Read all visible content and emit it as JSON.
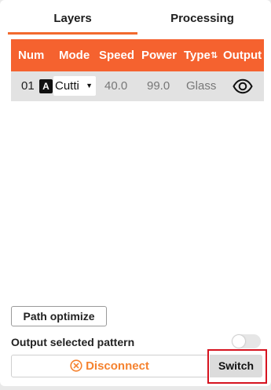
{
  "tabs": {
    "layers": "Layers",
    "processing": "Processing"
  },
  "table": {
    "headers": {
      "num": "Num",
      "mode": "Mode",
      "speed": "Speed",
      "power": "Power",
      "type": "Type",
      "type_sort": "⇅",
      "output": "Output"
    },
    "rows": [
      {
        "num": "01",
        "badge": "A",
        "mode": "Cutti",
        "speed": "40.0",
        "power": "99.0",
        "type": "Glass",
        "output_icon": "eye-icon"
      }
    ]
  },
  "controls": {
    "path_optimize": "Path optimize",
    "output_selected_label": "Output selected pattern",
    "output_selected_enabled": false,
    "disconnect": "Disconnect",
    "switch": "Switch"
  },
  "colors": {
    "accent": "#f5622f",
    "disconnect_text": "#f5822f",
    "highlight_border": "#d6131f"
  }
}
